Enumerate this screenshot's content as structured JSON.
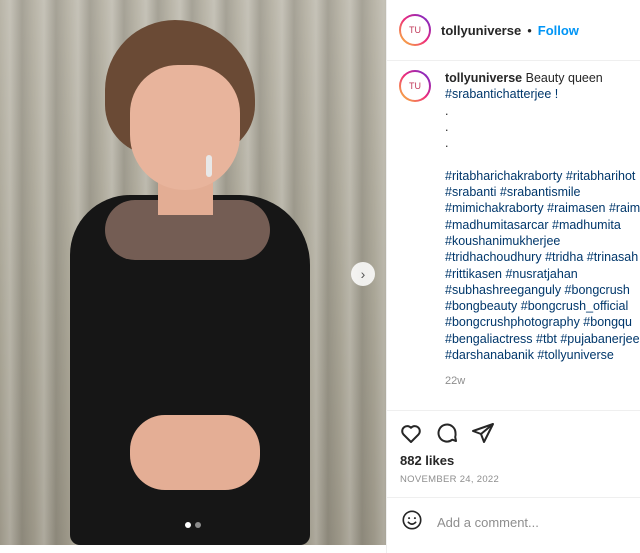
{
  "post": {
    "username": "tollyuniverse",
    "avatar_text": "TU",
    "follow_label": "Follow",
    "separator": "•"
  },
  "caption": {
    "username": "tollyuniverse",
    "text": "Beauty queen",
    "first_tag": "#srabantichatterjee !",
    "dots": [
      ".",
      ".",
      "."
    ],
    "tags": [
      "#ritabharichakraborty #ritabharihot",
      "#srabanti #srabantismile",
      "#mimichakraborty #raimasen #raim",
      "#madhumitasarcar #madhumita",
      "#koushanimukherjee",
      "#tridhachoudhury #tridha #trinasah",
      "#rittikasen #nusratjahan",
      "#subhashreeganguly #bongcrush",
      "#bongbeauty #bongcrush_official",
      "#bongcrushphotography #bongqu",
      "#bengaliactress #tbt #pujabanerjee",
      "#darshanabanik #tollyuniverse"
    ],
    "time_ago": "22w"
  },
  "stats": {
    "likes": "882 likes",
    "date": "NOVEMBER 24, 2022"
  },
  "comment": {
    "placeholder": "Add a comment..."
  },
  "icons": [
    "heart-icon",
    "comment-icon",
    "share-icon",
    "emoji-icon",
    "chevron-right-icon"
  ],
  "colors": {
    "accent": "#0095f6",
    "hashtag": "#00376b",
    "muted": "#8e8e8e"
  },
  "carousel": {
    "slides": 2,
    "active": 1
  }
}
